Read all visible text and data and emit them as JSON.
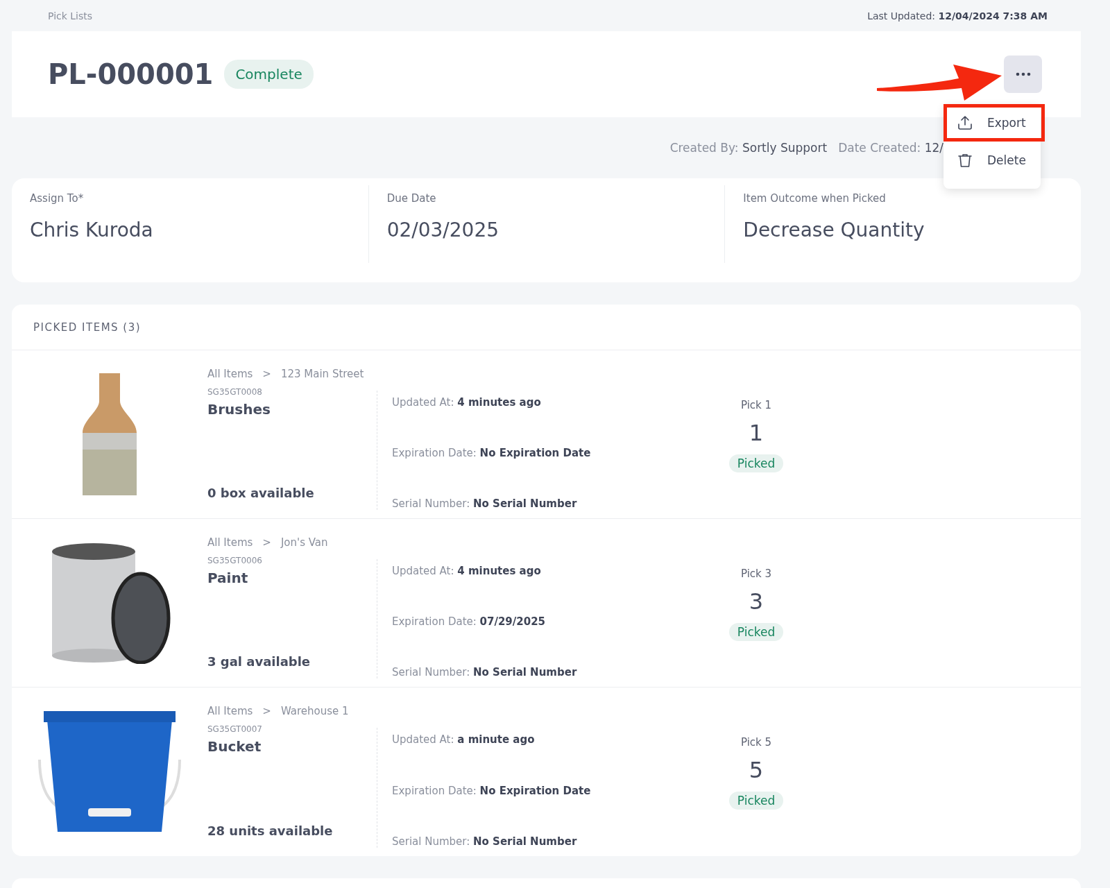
{
  "breadcrumb": "Pick Lists",
  "last_updated": {
    "label": "Last Updated:",
    "value": "12/04/2024 7:38 AM"
  },
  "header": {
    "title": "PL-000001",
    "status": "Complete"
  },
  "menu": {
    "items": [
      {
        "label": "Export",
        "kind": "export",
        "highlighted": true
      },
      {
        "label": "Delete",
        "kind": "delete",
        "highlighted": false
      }
    ]
  },
  "meta": [
    {
      "label": "Created By:",
      "value": "Sortly Support"
    },
    {
      "label": "Date Created:",
      "value": "12/"
    }
  ],
  "fields": [
    {
      "label": "Assign To*",
      "value": "Chris Kuroda"
    },
    {
      "label": "Due Date",
      "value": "02/03/2025"
    },
    {
      "label": "Item Outcome when Picked",
      "value": "Decrease Quantity"
    }
  ],
  "picked_items": {
    "title": "PICKED ITEMS (3)",
    "items": [
      {
        "kind": "brush",
        "path": [
          "All Items",
          "123 Main Street"
        ],
        "separator": ">",
        "sku": "SG35GT0008",
        "name": "Brushes",
        "available": "0 box available",
        "details": [
          {
            "label": "Updated At:",
            "value": "4 minutes ago"
          },
          {
            "label": "Expiration Date:",
            "value": "No Expiration Date"
          },
          {
            "label": "Serial Number:",
            "value": "No Serial Number"
          }
        ],
        "pick_label": "Pick 1",
        "pick_qty": "1",
        "status": "Picked"
      },
      {
        "kind": "can",
        "path": [
          "All Items",
          "Jon's Van"
        ],
        "separator": ">",
        "sku": "SG35GT0006",
        "name": "Paint",
        "available": "3 gal available",
        "details": [
          {
            "label": "Updated At:",
            "value": "4 minutes ago"
          },
          {
            "label": "Expiration Date:",
            "value": "07/29/2025"
          },
          {
            "label": "Serial Number:",
            "value": "No Serial Number"
          }
        ],
        "pick_label": "Pick 3",
        "pick_qty": "3",
        "status": "Picked"
      },
      {
        "kind": "bucket",
        "path": [
          "All Items",
          "Warehouse 1"
        ],
        "separator": ">",
        "sku": "SG35GT0007",
        "name": "Bucket",
        "available": "28 units available",
        "details": [
          {
            "label": "Updated At:",
            "value": "a minute ago"
          },
          {
            "label": "Expiration Date:",
            "value": "No Expiration Date"
          },
          {
            "label": "Serial Number:",
            "value": "No Serial Number"
          }
        ],
        "pick_label": "Pick 5",
        "pick_qty": "5",
        "status": "Picked"
      }
    ]
  }
}
